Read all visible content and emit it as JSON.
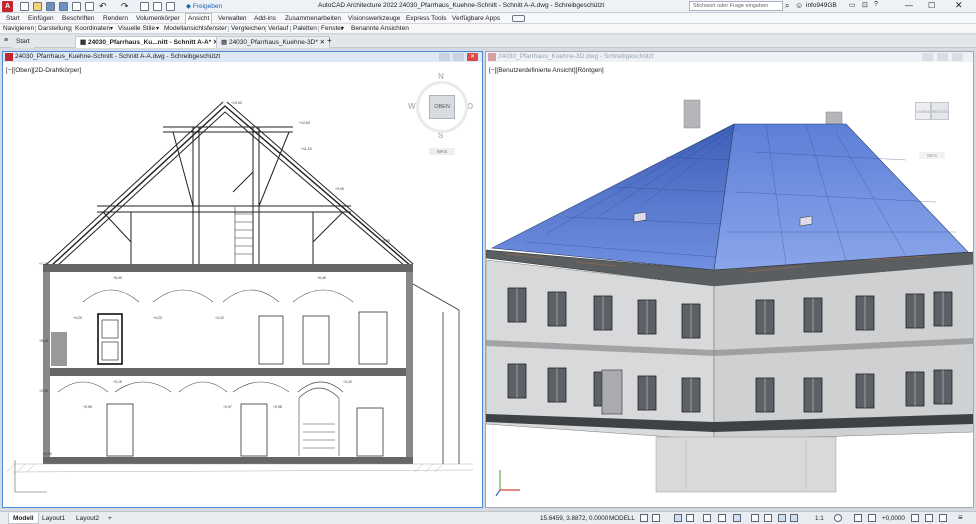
{
  "app": {
    "title": "AutoCAD Architecture 2022",
    "file_title": "24030_Pfarrhaus_Kuehne-Schnitt - Schnitt A-A.dwg - Schreibgeschützt",
    "share_label": "Freigeben",
    "search_placeholder": "Stichwort oder Frage eingeben",
    "user": "info949GB"
  },
  "menu": {
    "items": [
      "Start",
      "Einfügen",
      "Beschriften",
      "Rendern",
      "Volumenkörper",
      "Ansicht",
      "Verwalten",
      "Add-ins",
      "Zusammenarbeiten",
      "Visionswerkzeuge",
      "Express Tools",
      "Verfügbare Apps"
    ],
    "active": "Ansicht"
  },
  "ribbon": {
    "items": [
      "Navigieren",
      "Darstellung",
      "Koordinaten",
      "Visuelle Stile",
      "Modellansichtsfenster",
      "Vergleichen",
      "Verlauf",
      "Paletten",
      "Fenster",
      "Benannte Ansichten"
    ]
  },
  "tabs": {
    "start": "Start",
    "items": [
      {
        "label": "24030_Pfarrhaus_Ku...nitt - Schnitt A-A*",
        "active": true
      },
      {
        "label": "24030_Pfarrhaus_Kuehne-3D*",
        "active": false
      }
    ],
    "add": "+"
  },
  "viewport_left": {
    "title": "24030_Pfarrhaus_Kuehne-Schnitt - Schnitt A-A.dwg - Schreibgeschützt",
    "label": "[−][Oben][2D-Drahtkörper]",
    "viewcube": {
      "top": "OBEN",
      "n": "N",
      "s": "S",
      "w": "W",
      "e": "O",
      "wcs": "WKS"
    }
  },
  "viewport_right": {
    "title": "24030_Pfarrhaus_Kuehne-3D.dwg - Schreibgeschützt",
    "label": "[−][Benutzerdefinierte Ansicht][Röntgen]",
    "viewcube": {
      "front": "VORNE",
      "right": "RECHTS",
      "wcs": "WKS"
    }
  },
  "section_labels": {
    "top": "+13,90",
    "ridge": "+12,50",
    "level_a": "+11,15",
    "level_b": "+9,90",
    "level_c": "+8,55",
    "attic": "+7,45",
    "floor2": "+6,40",
    "floor2b": "+6,45",
    "mid1": "+4,20",
    "mid2": "+4,23",
    "mid3": "+4,22",
    "floor1": "+3,15",
    "floor1b": "+3,20",
    "low1": "+0,95",
    "low2": "+0,97",
    "low3": "+0,98",
    "ground": "±0,00",
    "side1": "+5,15",
    "side2": "+2,50"
  },
  "statusbar": {
    "layouts": [
      "Modell",
      "Layout1",
      "Layout2"
    ],
    "active_layout": "Modell",
    "add": "+",
    "coords": "15.6459, 3.8872, 0.0000",
    "mode": "MODELL",
    "scale": "1:1",
    "precision": "+0,0000"
  }
}
